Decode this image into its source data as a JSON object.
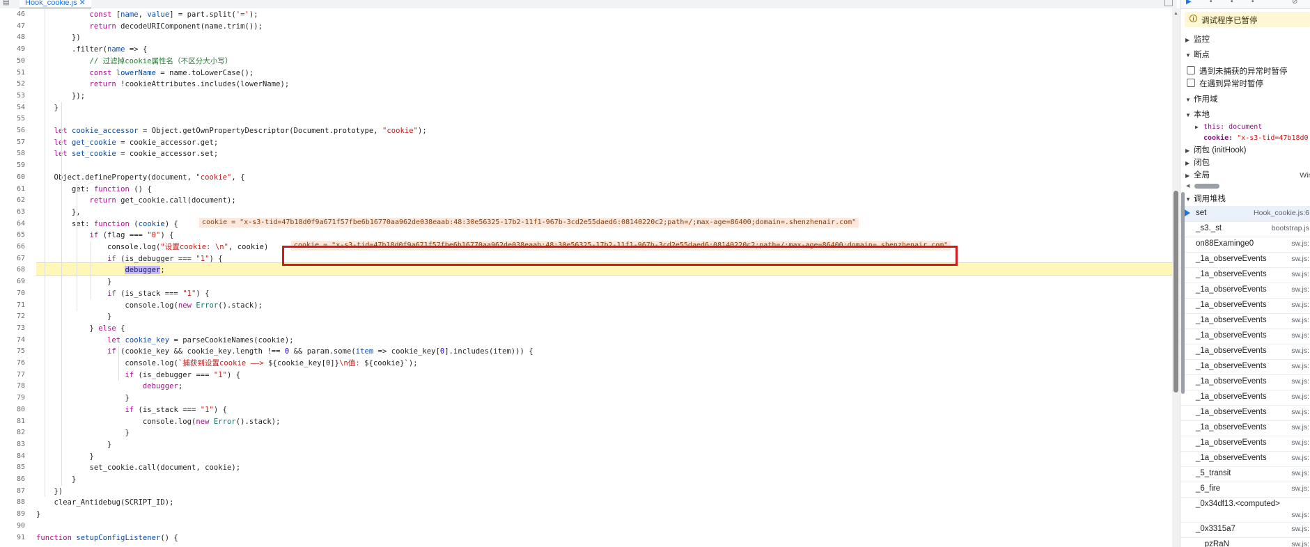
{
  "tab": {
    "label": "Hook_cookie.js"
  },
  "code": {
    "lines": [
      {
        "n": "46",
        "tokens": [
          {
            "t": "            "
          },
          {
            "t": "const",
            "c": "kw"
          },
          {
            "t": " ["
          },
          {
            "t": "name",
            "c": "var"
          },
          {
            "t": ", "
          },
          {
            "t": "value",
            "c": "var"
          },
          {
            "t": "] = part.split("
          },
          {
            "t": "'='",
            "c": "str"
          },
          {
            "t": ");"
          }
        ]
      },
      {
        "n": "47",
        "tokens": [
          {
            "t": "            "
          },
          {
            "t": "return",
            "c": "kw"
          },
          {
            "t": " decodeURIComponent(name.trim());"
          }
        ]
      },
      {
        "n": "48",
        "tokens": [
          {
            "t": "        })"
          }
        ]
      },
      {
        "n": "49",
        "tokens": [
          {
            "t": "        .filter("
          },
          {
            "t": "name",
            "c": "var"
          },
          {
            "t": " => {"
          }
        ]
      },
      {
        "n": "50",
        "tokens": [
          {
            "t": "            "
          },
          {
            "t": "// 过滤掉cookie属性名（不区分大小写）",
            "c": "cm"
          }
        ]
      },
      {
        "n": "51",
        "tokens": [
          {
            "t": "            "
          },
          {
            "t": "const",
            "c": "kw"
          },
          {
            "t": " "
          },
          {
            "t": "lowerName",
            "c": "var"
          },
          {
            "t": " = name.toLowerCase();"
          }
        ]
      },
      {
        "n": "52",
        "tokens": [
          {
            "t": "            "
          },
          {
            "t": "return",
            "c": "kw"
          },
          {
            "t": " !cookieAttributes.includes(lowerName);"
          }
        ]
      },
      {
        "n": "53",
        "tokens": [
          {
            "t": "        });"
          }
        ]
      },
      {
        "n": "54",
        "tokens": [
          {
            "t": "    }"
          }
        ]
      },
      {
        "n": "55",
        "tokens": [
          {
            "t": ""
          }
        ]
      },
      {
        "n": "56",
        "tokens": [
          {
            "t": "    "
          },
          {
            "t": "let",
            "c": "kw"
          },
          {
            "t": " "
          },
          {
            "t": "cookie_accessor",
            "c": "var"
          },
          {
            "t": " = Object.getOwnPropertyDescriptor(Document.prototype, "
          },
          {
            "t": "\"cookie\"",
            "c": "str"
          },
          {
            "t": ");"
          }
        ]
      },
      {
        "n": "57",
        "tokens": [
          {
            "t": "    "
          },
          {
            "t": "let",
            "c": "kw"
          },
          {
            "t": " "
          },
          {
            "t": "get_cookie",
            "c": "var"
          },
          {
            "t": " = cookie_accessor.get;"
          }
        ]
      },
      {
        "n": "58",
        "tokens": [
          {
            "t": "    "
          },
          {
            "t": "let",
            "c": "kw"
          },
          {
            "t": " "
          },
          {
            "t": "set_cookie",
            "c": "var"
          },
          {
            "t": " = cookie_accessor.set;"
          }
        ]
      },
      {
        "n": "59",
        "tokens": [
          {
            "t": ""
          }
        ]
      },
      {
        "n": "60",
        "tokens": [
          {
            "t": "    Object.defineProperty(document, "
          },
          {
            "t": "\"cookie\"",
            "c": "str"
          },
          {
            "t": ", {"
          }
        ]
      },
      {
        "n": "61",
        "tokens": [
          {
            "t": "        get: "
          },
          {
            "t": "function",
            "c": "kw"
          },
          {
            "t": " () {"
          }
        ]
      },
      {
        "n": "62",
        "tokens": [
          {
            "t": "            "
          },
          {
            "t": "return",
            "c": "kw"
          },
          {
            "t": " get_cookie.call(document);"
          }
        ]
      },
      {
        "n": "63",
        "tokens": [
          {
            "t": "        },"
          }
        ]
      },
      {
        "n": "64",
        "tokens": [
          {
            "t": "        set: "
          },
          {
            "t": "function",
            "c": "kw"
          },
          {
            "t": " ("
          },
          {
            "t": "cookie",
            "c": "var"
          },
          {
            "t": ") {"
          }
        ]
      },
      {
        "n": "65",
        "tokens": [
          {
            "t": "            "
          },
          {
            "t": "if",
            "c": "kw"
          },
          {
            "t": " (flag === "
          },
          {
            "t": "\"0\"",
            "c": "str"
          },
          {
            "t": ") {"
          }
        ]
      },
      {
        "n": "66",
        "tokens": [
          {
            "t": "                console.log("
          },
          {
            "t": "\"设置cookie: \\n\"",
            "c": "str"
          },
          {
            "t": ", cookie)"
          }
        ]
      },
      {
        "n": "67",
        "tokens": [
          {
            "t": "                "
          },
          {
            "t": "if",
            "c": "kw"
          },
          {
            "t": " (is_debugger === "
          },
          {
            "t": "\"1\"",
            "c": "str"
          },
          {
            "t": ") {"
          }
        ]
      },
      {
        "n": "68",
        "tokens": [
          {
            "t": "                    "
          },
          {
            "t": "debugger",
            "c": "dbg"
          },
          {
            "t": ";"
          }
        ]
      },
      {
        "n": "69",
        "tokens": [
          {
            "t": "                }"
          }
        ]
      },
      {
        "n": "70",
        "tokens": [
          {
            "t": "                "
          },
          {
            "t": "if",
            "c": "kw"
          },
          {
            "t": " (is_stack === "
          },
          {
            "t": "\"1\"",
            "c": "str"
          },
          {
            "t": ") {"
          }
        ]
      },
      {
        "n": "71",
        "tokens": [
          {
            "t": "                    console.log("
          },
          {
            "t": "new",
            "c": "kw"
          },
          {
            "t": " "
          },
          {
            "t": "Error",
            "c": "ty"
          },
          {
            "t": "().stack);"
          }
        ]
      },
      {
        "n": "72",
        "tokens": [
          {
            "t": "                }"
          }
        ]
      },
      {
        "n": "73",
        "tokens": [
          {
            "t": "            } "
          },
          {
            "t": "else",
            "c": "kw"
          },
          {
            "t": " {"
          }
        ]
      },
      {
        "n": "74",
        "tokens": [
          {
            "t": "                "
          },
          {
            "t": "let",
            "c": "kw"
          },
          {
            "t": " "
          },
          {
            "t": "cookie_key",
            "c": "var"
          },
          {
            "t": " = parseCookieNames(cookie);"
          }
        ]
      },
      {
        "n": "75",
        "tokens": [
          {
            "t": "                "
          },
          {
            "t": "if",
            "c": "kw"
          },
          {
            "t": " (cookie_key && cookie_key.length !== "
          },
          {
            "t": "0",
            "c": "num"
          },
          {
            "t": " && param.some("
          },
          {
            "t": "item",
            "c": "var"
          },
          {
            "t": " => cookie_key["
          },
          {
            "t": "0",
            "c": "num"
          },
          {
            "t": "].includes(item))) {"
          }
        ]
      },
      {
        "n": "76",
        "tokens": [
          {
            "t": "                    console.log(`"
          },
          {
            "t": "捕获到设置cookie ——> ",
            "c": "str"
          },
          {
            "t": "${cookie_key[0]}"
          },
          {
            "t": "\\n值: ",
            "c": "str"
          },
          {
            "t": "${cookie}`);"
          }
        ]
      },
      {
        "n": "77",
        "tokens": [
          {
            "t": "                    "
          },
          {
            "t": "if",
            "c": "kw"
          },
          {
            "t": " (is_debugger === "
          },
          {
            "t": "\"1\"",
            "c": "str"
          },
          {
            "t": ") {"
          }
        ]
      },
      {
        "n": "78",
        "tokens": [
          {
            "t": "                        "
          },
          {
            "t": "debugger",
            "c": "kw"
          },
          {
            "t": ";"
          }
        ]
      },
      {
        "n": "79",
        "tokens": [
          {
            "t": "                    }"
          }
        ]
      },
      {
        "n": "80",
        "tokens": [
          {
            "t": "                    "
          },
          {
            "t": "if",
            "c": "kw"
          },
          {
            "t": " (is_stack === "
          },
          {
            "t": "\"1\"",
            "c": "str"
          },
          {
            "t": ") {"
          }
        ]
      },
      {
        "n": "81",
        "tokens": [
          {
            "t": "                        console.log("
          },
          {
            "t": "new",
            "c": "kw"
          },
          {
            "t": " "
          },
          {
            "t": "Error",
            "c": "ty"
          },
          {
            "t": "().stack);"
          }
        ]
      },
      {
        "n": "82",
        "tokens": [
          {
            "t": "                    }"
          }
        ]
      },
      {
        "n": "83",
        "tokens": [
          {
            "t": "                }"
          }
        ]
      },
      {
        "n": "84",
        "tokens": [
          {
            "t": "            }"
          }
        ]
      },
      {
        "n": "85",
        "tokens": [
          {
            "t": "            set_cookie.call(document, cookie);"
          }
        ]
      },
      {
        "n": "86",
        "tokens": [
          {
            "t": "        }"
          }
        ]
      },
      {
        "n": "87",
        "tokens": [
          {
            "t": "    })"
          }
        ]
      },
      {
        "n": "88",
        "tokens": [
          {
            "t": "    clear_Antidebug(SCRIPT_ID);"
          }
        ]
      },
      {
        "n": "89",
        "tokens": [
          {
            "t": "}"
          }
        ]
      },
      {
        "n": "90",
        "tokens": [
          {
            "t": ""
          }
        ]
      },
      {
        "n": "91",
        "tokens": [
          {
            "t": ""
          },
          {
            "t": "function",
            "c": "kw"
          },
          {
            "t": " "
          },
          {
            "t": "setupConfigListener",
            "c": "var"
          },
          {
            "t": "() {"
          }
        ]
      }
    ],
    "inline_value_64": "cookie = \"x-s3-tid=47b18d0f9a671f57fbe6b16770aa962de038eaab:48:30e56325-17b2-11f1-967b-3cd2e55daed6:08140220c2;path=/;max-age=86400;domain=.shenzhenair.com\"",
    "inline_value_66": "cookie = \"x-s3-tid=47b18d0f9a671f57fbe6b16770aa962de038eaab:48:30e56325-17b2-11f1-967b-3cd2e55daed6:08140220c2;path=/;max-age=86400;domain=.shenzhenair.com\""
  },
  "sidebar": {
    "paused_text": "调试程序已暂停",
    "watch_label": "监控",
    "breakpoints_label": "断点",
    "pause_uncaught_label": "遇到未捕获的异常时暂停",
    "pause_caught_label": "在遇到异常时暂停",
    "scope_label": "作用域",
    "local_label": "本地",
    "this_key": "this:",
    "this_val": "document",
    "cookie_key": "cookie:",
    "cookie_val": "\"x-s3-tid=47b18d0",
    "closure1_label": "闭包 (initHook)",
    "closure2_label": "闭包",
    "global_label": "全局",
    "global_val": "Wir",
    "callstack_label": "调用堆栈",
    "frames": [
      {
        "name": "set",
        "loc": "Hook_cookie.js:6"
      },
      {
        "name": "_s3._st",
        "loc": "bootstrap.js"
      },
      {
        "name": "on88Examinge0",
        "loc": "sw.js:"
      },
      {
        "name": "_1a_observeEvents",
        "loc": "sw.js:"
      },
      {
        "name": "_1a_observeEvents",
        "loc": "sw.js:"
      },
      {
        "name": "_1a_observeEvents",
        "loc": "sw.js:"
      },
      {
        "name": "_1a_observeEvents",
        "loc": "sw.js:"
      },
      {
        "name": "_1a_observeEvents",
        "loc": "sw.js:"
      },
      {
        "name": "_1a_observeEvents",
        "loc": "sw.js:"
      },
      {
        "name": "_1a_observeEvents",
        "loc": "sw.js:"
      },
      {
        "name": "_1a_observeEvents",
        "loc": "sw.js:"
      },
      {
        "name": "_1a_observeEvents",
        "loc": "sw.js:"
      },
      {
        "name": "_1a_observeEvents",
        "loc": "sw.js:"
      },
      {
        "name": "_1a_observeEvents",
        "loc": "sw.js:"
      },
      {
        "name": "_1a_observeEvents",
        "loc": "sw.js:"
      },
      {
        "name": "_1a_observeEvents",
        "loc": "sw.js:"
      },
      {
        "name": "_1a_observeEvents",
        "loc": "sw.js:"
      },
      {
        "name": "_5_transit",
        "loc": "sw.js:"
      },
      {
        "name": "_6_fire",
        "loc": "sw.js:"
      },
      {
        "name": "_0x34df13.<computed>",
        "loc": "sw.js:"
      },
      {
        "name": "_0x3315a7",
        "loc": "sw.js:"
      },
      {
        "name": "__pzRaN",
        "loc": "sw.js:"
      }
    ]
  },
  "colors": {
    "accent": "#1a73e8",
    "highlight_box": "#d21a1a",
    "paused_bg": "#fef7d6",
    "debug_line_bg": "#fff7b8"
  }
}
